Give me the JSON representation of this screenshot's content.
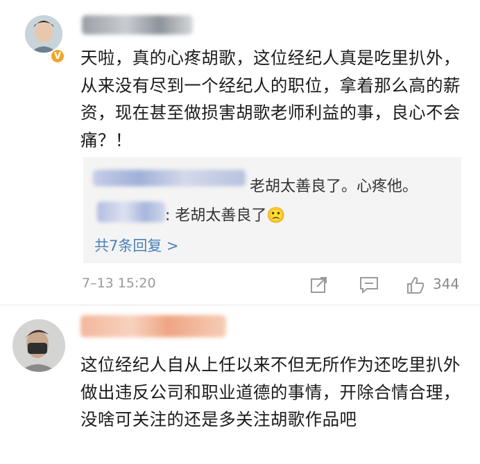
{
  "comment1": {
    "text": "天啦，真的心疼胡歌，这位经纪人真是吃里扒外，从来没有尽到一个经纪人的职位，拿着那么高的薪资，现在甚至做损害胡歌老师利益的事，良心不会痛？！",
    "replies": [
      {
        "text": "老胡太善良了。心疼他。"
      },
      {
        "text": ": 老胡太善良了",
        "emoji": "🙁"
      }
    ],
    "more_replies": "共7条回复 >",
    "timestamp": "7–13 15:20",
    "like_count": "344",
    "icons": [
      "share-icon",
      "comment-icon",
      "like-icon"
    ]
  },
  "comment2": {
    "text": "这位经纪人自从上任以来不但无所作为还吃里扒外做出违反公司和职业道德的事情，开除合情合理，没啥可关注的还是多关注胡歌作品吧"
  }
}
